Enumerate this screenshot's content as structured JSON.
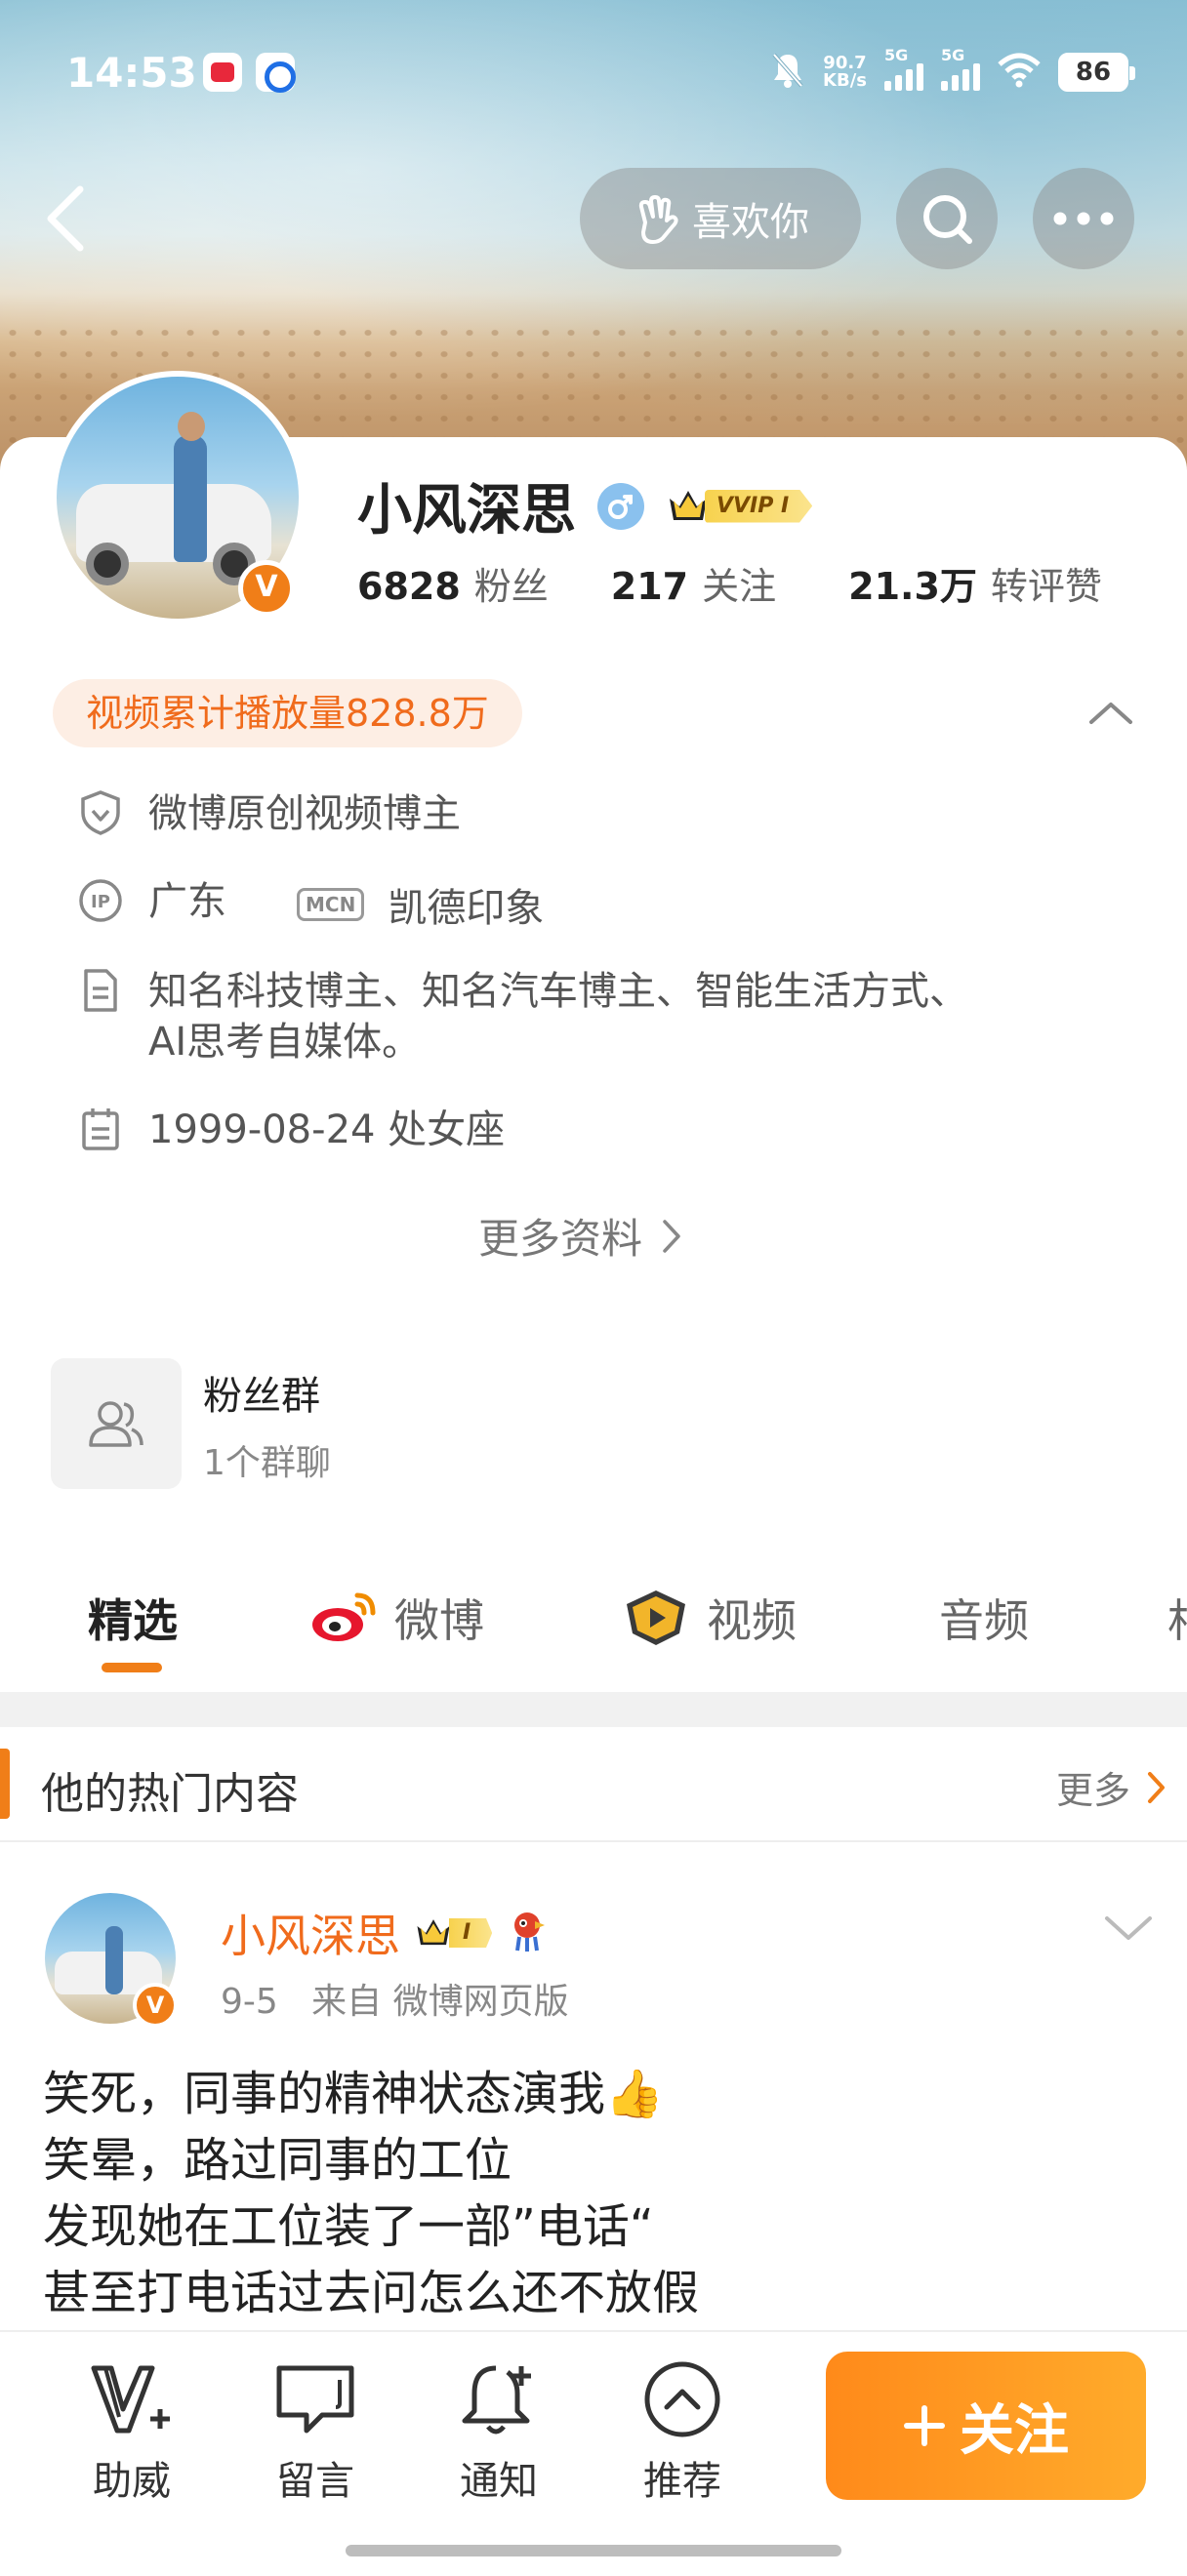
{
  "status_bar": {
    "time": "14:53",
    "net_speed_value": "90.7",
    "net_speed_unit": "KB/s",
    "signal1_label": "5G",
    "signal2_label": "5G",
    "battery": "86"
  },
  "header": {
    "like_label": "喜欢你"
  },
  "profile": {
    "name": "小风深思",
    "vip_label": "VVIP I",
    "avatar_badge": "V",
    "stats": {
      "fans_count": "6828",
      "fans_label": "粉丝",
      "following_count": "217",
      "following_label": "关注",
      "likes_count": "21.3万",
      "likes_label": "转评赞"
    },
    "video_plays": "视频累计播放量828.8万",
    "verification": "微博原创视频博主",
    "ip_location": "广东",
    "mcn_tag": "MCN",
    "mcn_name": "凯德印象",
    "bio_line1": "知名科技博主、知名汽车博主、智能生活方式、",
    "bio_line2": "AI思考自媒体。",
    "birthday": "1999-08-24 处女座",
    "more_info": "更多资料"
  },
  "fan_group": {
    "title": "粉丝群",
    "subtitle": "1个群聊"
  },
  "tabs": [
    {
      "label": "精选"
    },
    {
      "label": "微博"
    },
    {
      "label": "视频"
    },
    {
      "label": "音频"
    },
    {
      "label": "相"
    }
  ],
  "hot_section": {
    "title": "他的热门内容",
    "more": "更多"
  },
  "post": {
    "author": "小风深思",
    "vip_level": "I",
    "badge": "V",
    "date": "9-5",
    "source": "来自 微博网页版",
    "lines": [
      "笑死，同事的精神状态演我👍",
      "笑晕，路过同事的工位",
      "发现她在工位装了一部”电话“",
      "甚至打电话过去问怎么还不放假"
    ]
  },
  "bottom_bar": {
    "items": [
      {
        "label": "助威"
      },
      {
        "label": "留言"
      },
      {
        "label": "通知"
      },
      {
        "label": "推荐"
      }
    ],
    "follow_label": "关注"
  },
  "colors": {
    "accent": "#f07e18",
    "vip_gold": "#f7d24e",
    "follow_gradient_start": "#ff8a1a",
    "follow_gradient_end": "#ffab2b"
  }
}
